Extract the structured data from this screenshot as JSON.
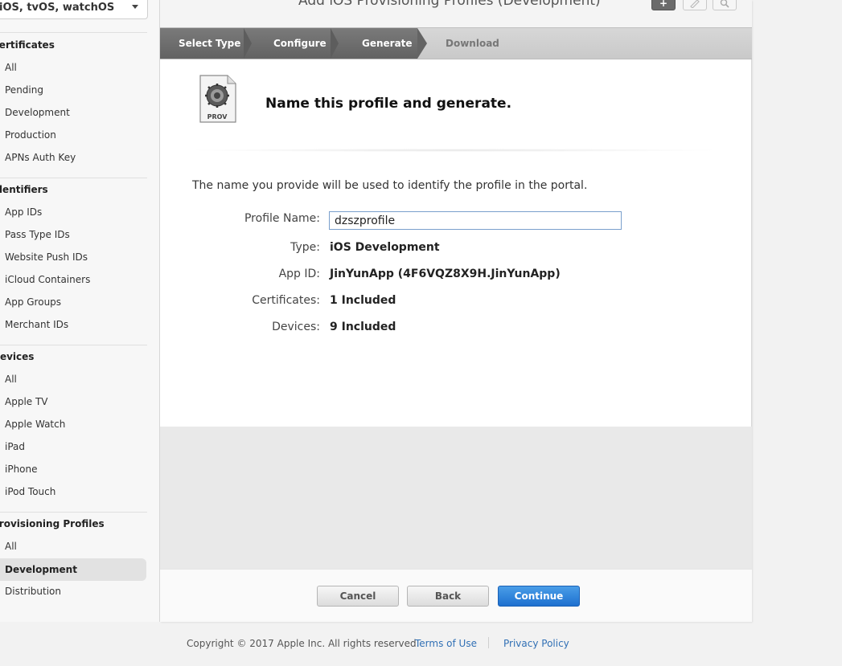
{
  "sidebar": {
    "platform_select": "iOS, tvOS, watchOS",
    "certificates": {
      "heading": "Certificates",
      "items": [
        "All",
        "Pending",
        "Development",
        "Production",
        "APNs Auth Key"
      ]
    },
    "identifiers": {
      "heading": "Identifiers",
      "items": [
        "App IDs",
        "Pass Type IDs",
        "Website Push IDs",
        "iCloud Containers",
        "App Groups",
        "Merchant IDs"
      ]
    },
    "devices": {
      "heading": "Devices",
      "items": [
        "All",
        "Apple TV",
        "Apple Watch",
        "iPad",
        "iPhone",
        "iPod Touch"
      ]
    },
    "profiles": {
      "heading": "Provisioning Profiles",
      "items": [
        "All",
        "Development",
        "Distribution"
      ],
      "active": "Development"
    }
  },
  "header": {
    "title": "Add iOS Provisioning Profiles (Development)",
    "icons": [
      "add-icon",
      "edit-icon",
      "search-icon"
    ]
  },
  "steps": [
    {
      "label": "Select Type",
      "state": "done"
    },
    {
      "label": "Configure",
      "state": "done"
    },
    {
      "label": "Generate",
      "state": "current"
    },
    {
      "label": "Download",
      "state": "todo"
    }
  ],
  "main": {
    "icon_label": "PROV",
    "heading": "Name this profile and generate.",
    "intro": "The name you provide will be used to identify the profile in the portal.",
    "profile_name_label": "Profile Name:",
    "profile_name_value": "dzszprofile",
    "type_label": "Type:",
    "type_value": "iOS Development",
    "app_id_label": "App ID:",
    "app_id_value": "JinYunApp (4F6VQZ8X9H.JinYunApp)",
    "certificates_label": "Certificates:",
    "certificates_value": "1 Included",
    "devices_label": "Devices:",
    "devices_value": "9 Included"
  },
  "buttons": {
    "cancel": "Cancel",
    "back": "Back",
    "continue": "Continue"
  },
  "footer": {
    "copyright": "Copyright © 2017 Apple Inc. All rights reserved.",
    "terms": "Terms of Use",
    "privacy": "Privacy Policy"
  },
  "colors": {
    "accent": "#1d6fcf",
    "link": "#3170b5",
    "step_done": "#6e6e6e"
  }
}
